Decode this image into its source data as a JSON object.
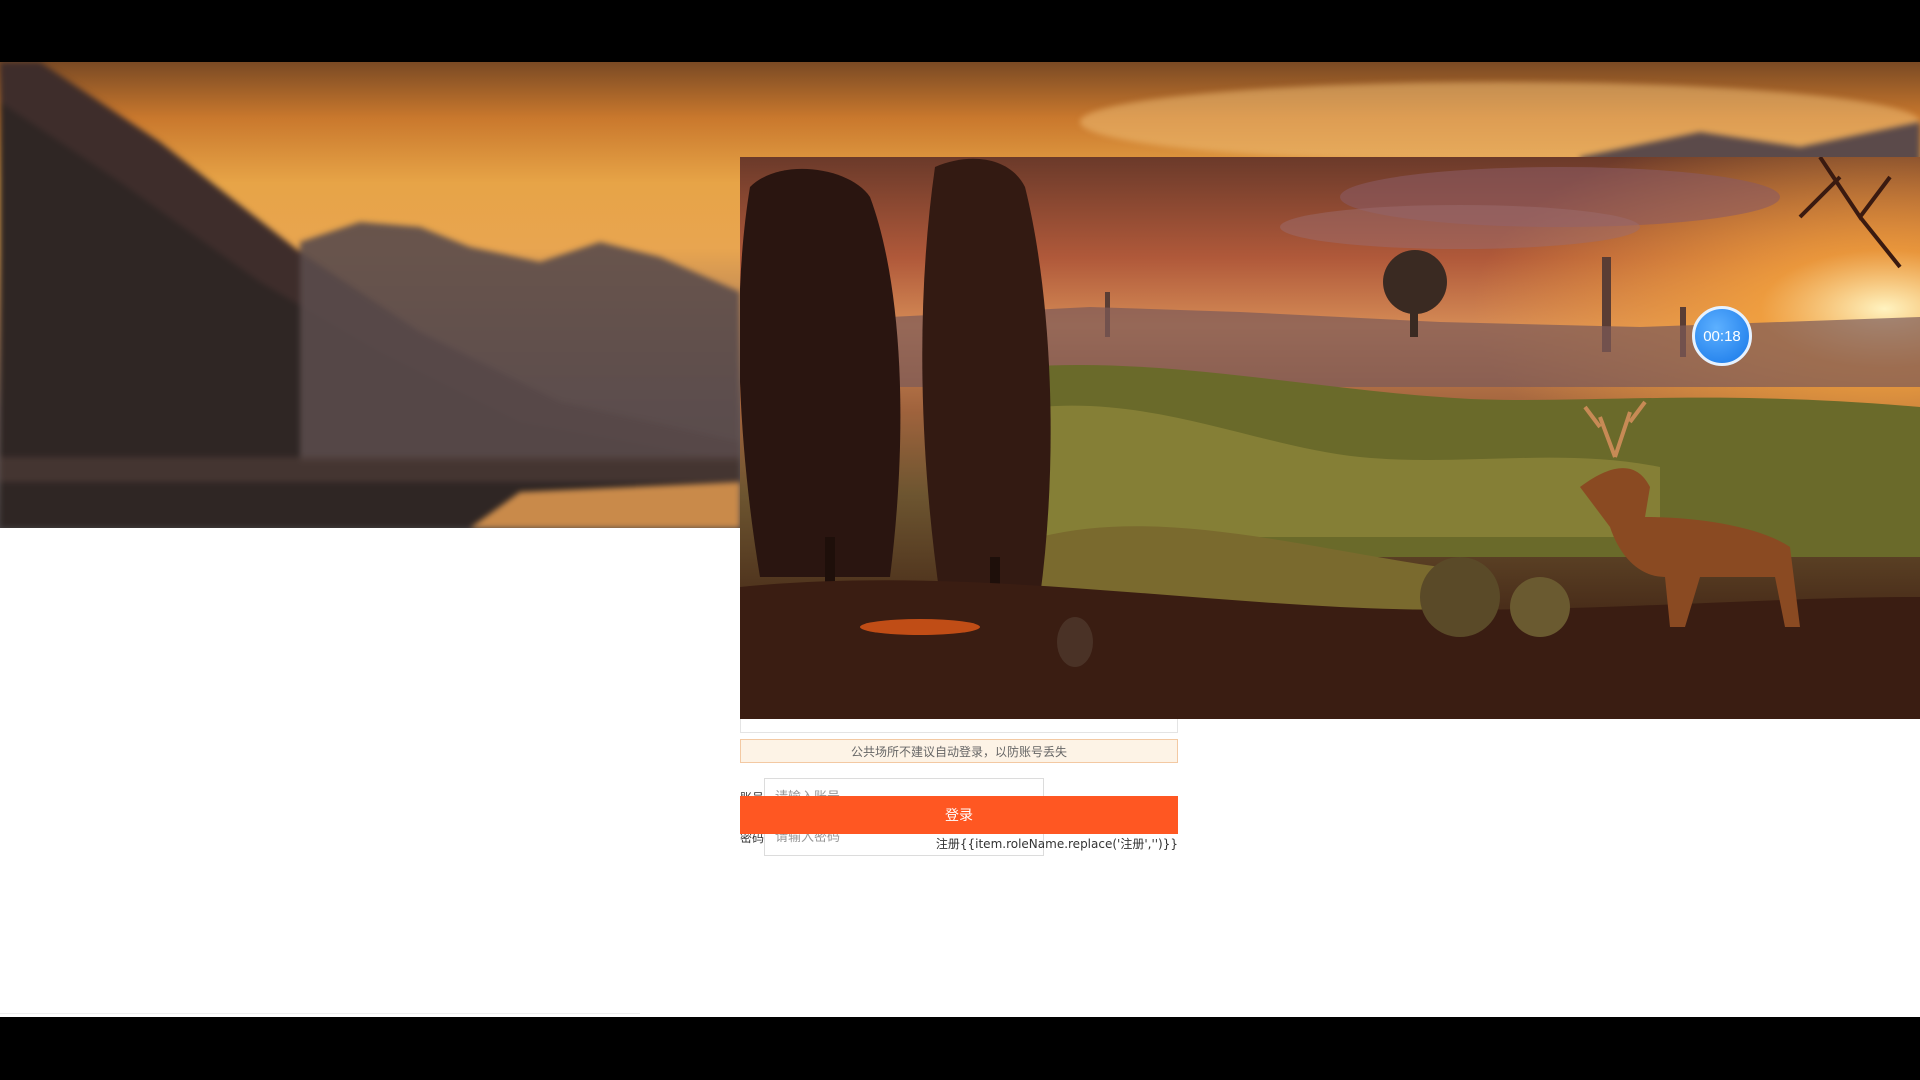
{
  "timer": {
    "text": "00:18"
  },
  "notice": {
    "text": "公共场所不建议自动登录，以防账号丢失"
  },
  "form": {
    "account_label": "账号",
    "account_placeholder": "请输入账号",
    "password_label": "密码",
    "password_placeholder": "请输入密码",
    "login_label": "登录",
    "register_label": "注册{{item.roleName.replace('注册','')}}"
  },
  "colors": {
    "login_button": "#ff5722",
    "notice_bg": "#fdf3e6",
    "timer": "#1677e8"
  }
}
